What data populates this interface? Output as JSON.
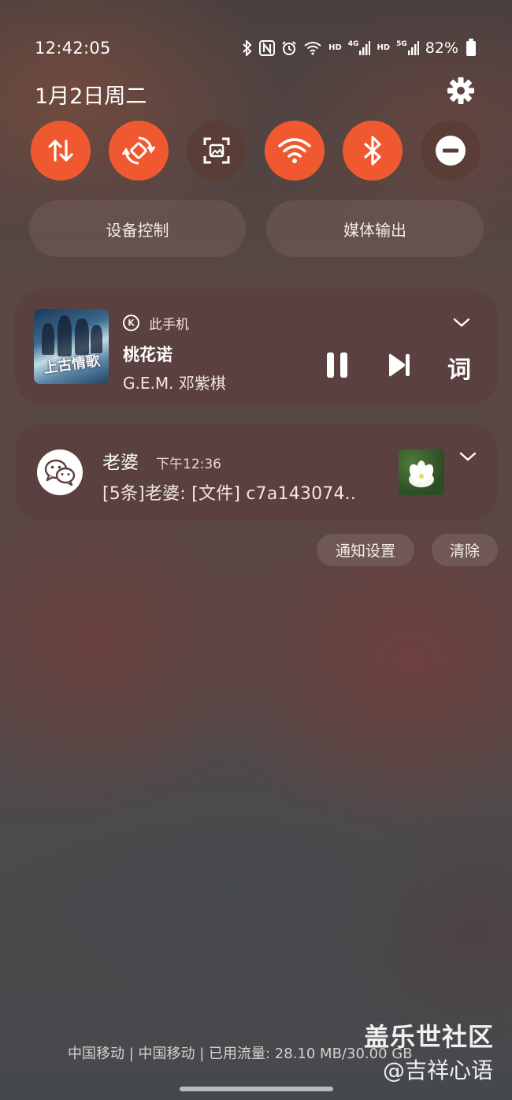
{
  "status_bar": {
    "time": "12:42:05",
    "network_hd_1": "HD",
    "network_4g": "4G",
    "network_hd_2": "HD",
    "network_5g": "5G",
    "battery": "82%"
  },
  "header": {
    "date": "1月2日周二"
  },
  "quick_toggles": [
    {
      "name": "mobile-data",
      "icon": "data-transfer-icon",
      "state": "on"
    },
    {
      "name": "auto-rotate",
      "icon": "auto-rotate-icon",
      "state": "on"
    },
    {
      "name": "screenshot",
      "icon": "screen-capture-icon",
      "state": "off"
    },
    {
      "name": "wifi",
      "icon": "wifi-icon",
      "state": "on"
    },
    {
      "name": "bluetooth",
      "icon": "bluetooth-icon",
      "state": "on"
    },
    {
      "name": "do-not-disturb",
      "icon": "minus-circle-icon",
      "state": "off"
    }
  ],
  "colors": {
    "accent": "#f0592f",
    "toggle_off": "#5a3d35",
    "card": "#5a403f"
  },
  "buttons": {
    "device_control": "设备控制",
    "media_output": "媒体输出"
  },
  "media": {
    "source": "此手机",
    "title": "桃花诺",
    "artist": "G.E.M. 邓紫棋",
    "lyrics_label": "词",
    "album_art_text": "上古情歌"
  },
  "notification": {
    "sender": "老婆",
    "time": "下午12:36",
    "message": "[5条]老婆: [文件] c7a143074.."
  },
  "notification_actions": {
    "settings": "通知设置",
    "clear": "清除"
  },
  "footer": {
    "carrier": "中国移动 | 中国移动 | 已用流量: 28.10 MB/30.00 GB",
    "watermark_line1": "盖乐世社区",
    "watermark_line2": "@吉祥心语"
  }
}
